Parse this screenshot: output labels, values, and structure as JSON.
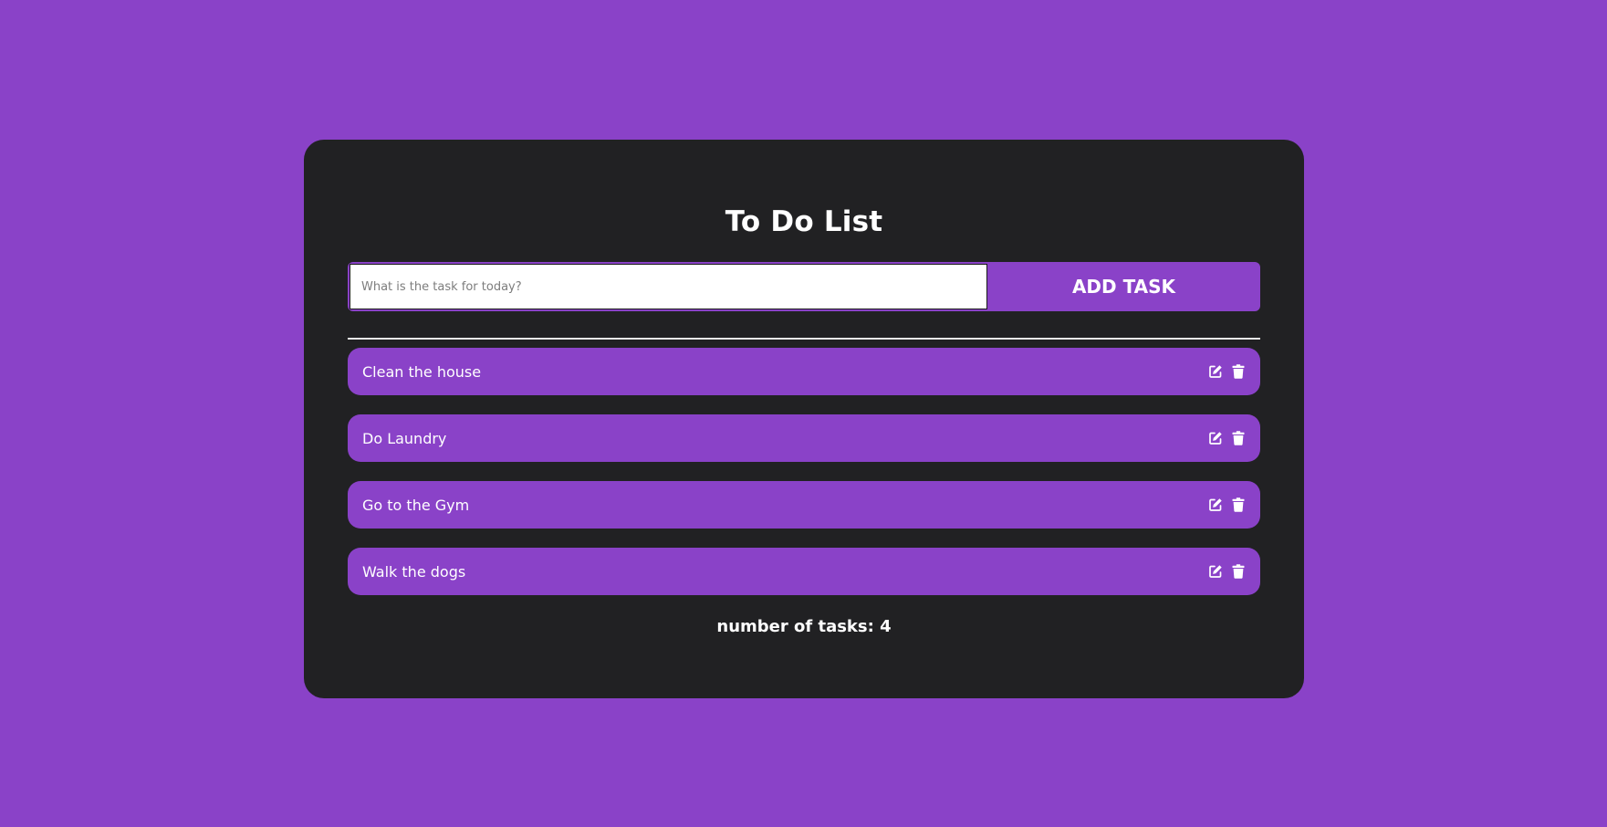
{
  "page": {
    "title": "To Do List"
  },
  "form": {
    "placeholder": "What is the task for today?",
    "value": "",
    "add_label": "ADD TASK"
  },
  "tasks": [
    {
      "label": "Clean the house",
      "edit_icon": "edit-icon",
      "delete_icon": "trash-icon"
    },
    {
      "label": "Do Laundry",
      "edit_icon": "edit-icon",
      "delete_icon": "trash-icon"
    },
    {
      "label": "Go to the Gym",
      "edit_icon": "edit-icon",
      "delete_icon": "trash-icon"
    },
    {
      "label": "Walk the dogs",
      "edit_icon": "edit-icon",
      "delete_icon": "trash-icon"
    }
  ],
  "footer": {
    "count_text": "number of tasks: 4"
  },
  "colors": {
    "background": "#8a42c8",
    "card": "#212123",
    "accent": "#8a42c8",
    "text": "#ffffff"
  }
}
